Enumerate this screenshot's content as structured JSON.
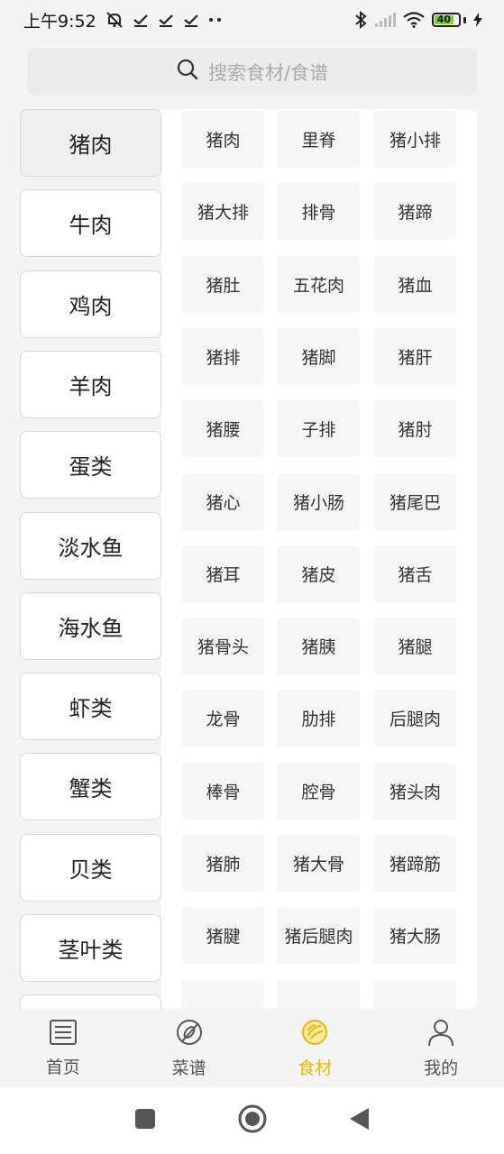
{
  "status_bar": {
    "time": "上午9:52",
    "battery_level": "40",
    "icons": [
      "mute-bell-icon",
      "check-icon",
      "check-icon",
      "check-icon",
      "dots-icon",
      "bluetooth-icon",
      "signal-icon",
      "wifi-icon",
      "battery-icon",
      "charging-icon"
    ]
  },
  "search": {
    "placeholder": "搜索食材/食谱",
    "icon": "search-icon"
  },
  "categories": [
    {
      "label": "猪肉",
      "active": true
    },
    {
      "label": "牛肉",
      "active": false
    },
    {
      "label": "鸡肉",
      "active": false
    },
    {
      "label": "羊肉",
      "active": false
    },
    {
      "label": "蛋类",
      "active": false
    },
    {
      "label": "淡水鱼",
      "active": false
    },
    {
      "label": "海水鱼",
      "active": false
    },
    {
      "label": "虾类",
      "active": false
    },
    {
      "label": "蟹类",
      "active": false
    },
    {
      "label": "贝类",
      "active": false
    },
    {
      "label": "茎叶类",
      "active": false
    },
    {
      "label": "",
      "active": false
    }
  ],
  "ingredients": [
    "猪肉",
    "里脊",
    "猪小排",
    "猪大排",
    "排骨",
    "猪蹄",
    "猪肚",
    "五花肉",
    "猪血",
    "猪排",
    "猪脚",
    "猪肝",
    "猪腰",
    "子排",
    "猪肘",
    "猪心",
    "猪小肠",
    "猪尾巴",
    "猪耳",
    "猪皮",
    "猪舌",
    "猪骨头",
    "猪胰",
    "猪腿",
    "龙骨",
    "肋排",
    "后腿肉",
    "棒骨",
    "腔骨",
    "猪头肉",
    "猪肺",
    "猪大骨",
    "猪蹄筋",
    "猪腱",
    "猪后腿肉",
    "猪大肠",
    "",
    "",
    ""
  ],
  "bottom_nav": [
    {
      "label": "首页",
      "icon": "home-list-icon",
      "active": false
    },
    {
      "label": "菜谱",
      "icon": "recipe-compass-icon",
      "active": false
    },
    {
      "label": "食材",
      "icon": "ingredient-cabbage-icon",
      "active": true
    },
    {
      "label": "我的",
      "icon": "profile-icon",
      "active": false
    }
  ],
  "colors": {
    "accent": "#e6b800",
    "battery": "#7cd32b"
  },
  "system_nav": [
    "recent-apps-icon",
    "home-circle-icon",
    "back-triangle-icon"
  ]
}
